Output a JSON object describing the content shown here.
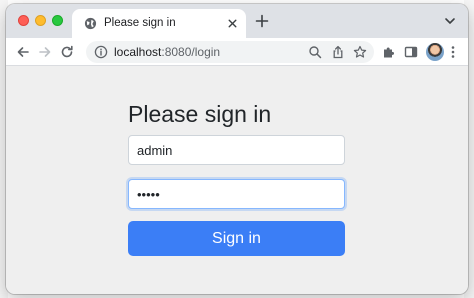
{
  "browser": {
    "tab": {
      "title": "Please sign in"
    },
    "address_bar": {
      "host": "localhost",
      "path": ":8080/login"
    },
    "colors": {
      "tabstrip": "#dee1e6",
      "accent": "#3b7ef6"
    }
  },
  "login": {
    "heading": "Please sign in",
    "username_value": "admin",
    "password_value": "•••••",
    "signin_label": "Sign in"
  }
}
